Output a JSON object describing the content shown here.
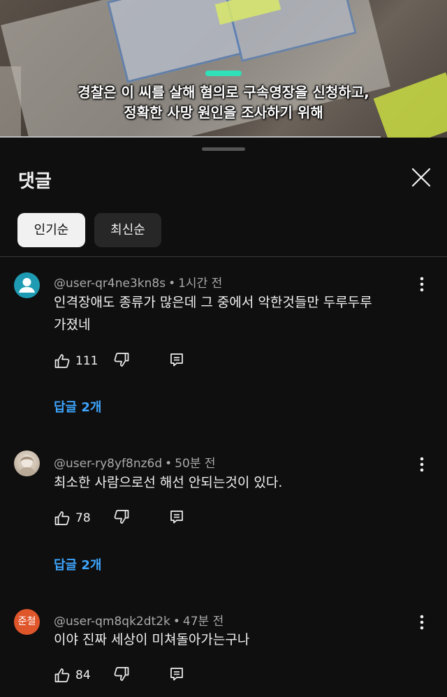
{
  "video": {
    "caption_line1": "경찰은 이 씨를 살해 혐의로 구속영장을 신청하고,",
    "caption_line2": "정확한 사망 원인을 조사하기 위해"
  },
  "sheet": {
    "title": "댓글",
    "sort_chips": [
      {
        "label": "인기순",
        "selected": true
      },
      {
        "label": "최신순",
        "selected": false
      }
    ]
  },
  "comments": [
    {
      "author": "@user-qr4ne3kn8s",
      "time": "1시간 전",
      "text_line1": "인격장애도 종류가 많은데 그 중에서 악한것들만 두루두루",
      "text_line2": "가졌네",
      "likes": "111",
      "replies": "답글 2개",
      "avatar": "default-person-icon"
    },
    {
      "author": "@user-ry8yf8nz6d",
      "time": "50분 전",
      "text_line1": "최소한 사람으로선 해선 안되는것이 있다.",
      "likes": "78",
      "replies": "답글 2개",
      "avatar": "photo"
    },
    {
      "author": "@user-qm8qk2dt2k",
      "time": "47분 전",
      "text_line1": "이야 진짜 세상이 미쳐돌아가는구나",
      "likes": "84",
      "avatar_text": "준철"
    }
  ],
  "colors": {
    "background": "#0f0f0f",
    "link_blue": "#3ea6ff",
    "progress_accent": "#2fe0b8",
    "avatar_teal": "#1e9bb2",
    "avatar_orange": "#e0562b"
  }
}
